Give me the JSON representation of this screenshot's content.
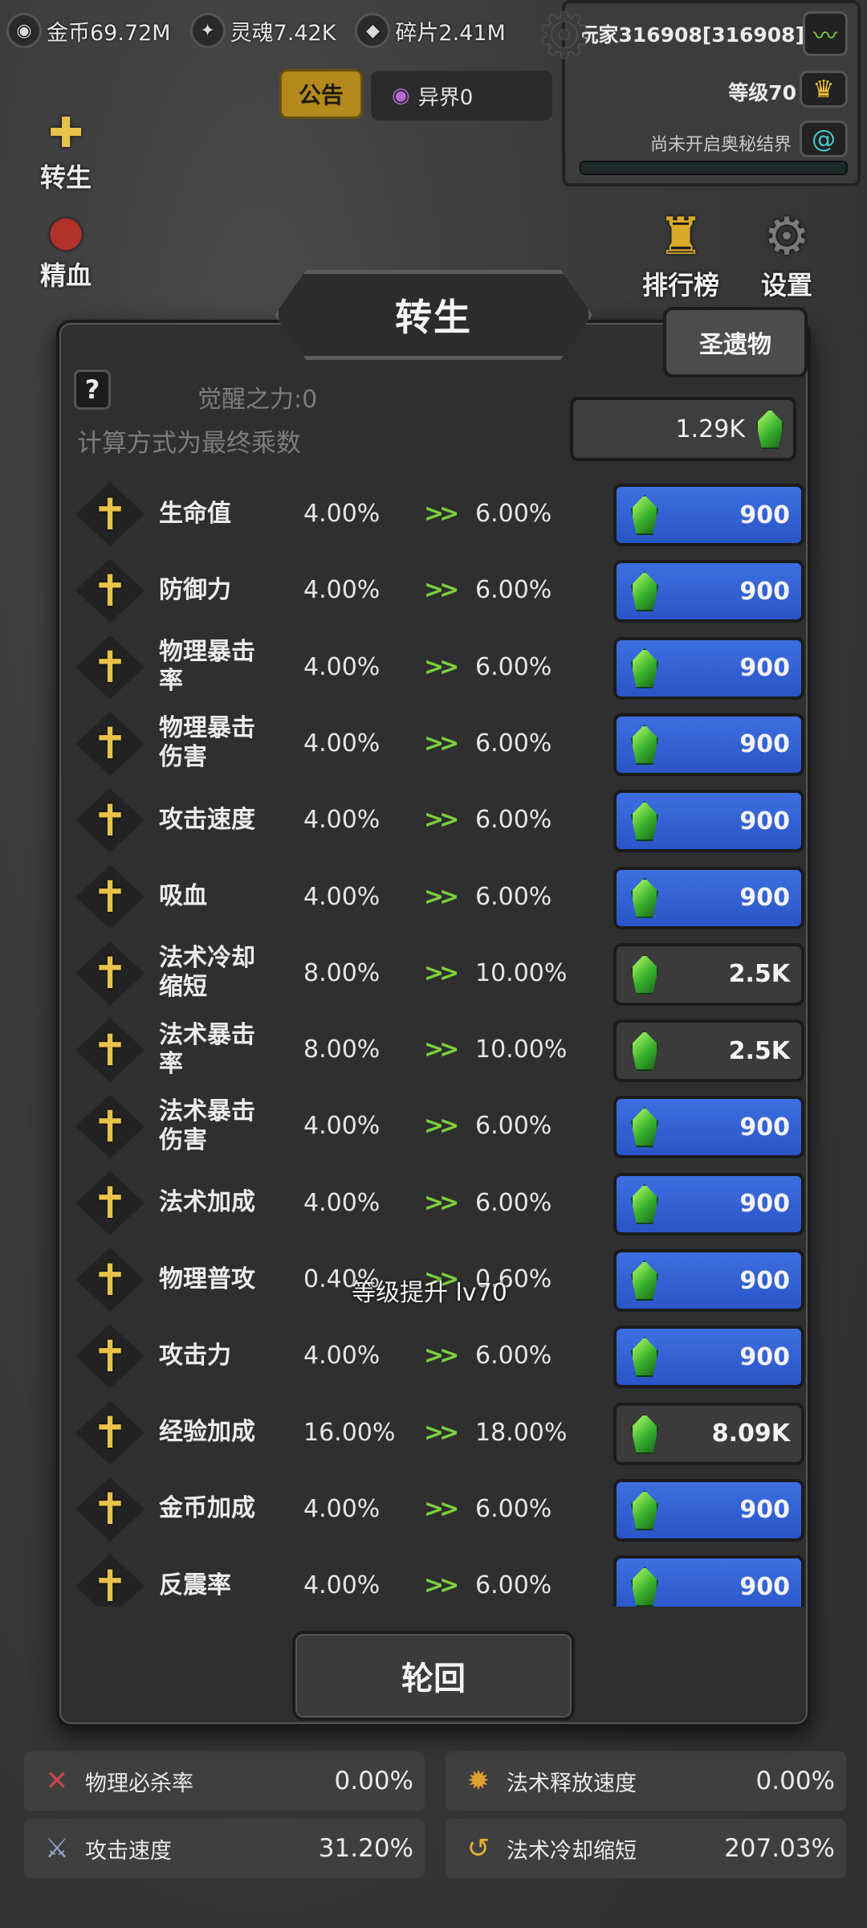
{
  "topbar": {
    "gold": "金币69.72M",
    "soul": "灵魂7.42K",
    "fragment": "碎片2.41M"
  },
  "player": {
    "name": "玩家316908[316908]",
    "level": "等级70",
    "secret": "尚未开启奥秘结界"
  },
  "top_buttons": {
    "notice": "公告",
    "otherworld": "异界0"
  },
  "side_menu": {
    "rebirth": "转生",
    "essence": "精血"
  },
  "right_icons": {
    "ranking": "排行榜",
    "settings": "设置"
  },
  "modal": {
    "title": "转生",
    "relic_button": "圣遗物",
    "help": "?",
    "awaken": "觉醒之力:0",
    "calc_note": "计算方式为最终乘数",
    "total": "1.29K",
    "levelup_toast": "等级提升 lv70",
    "reincarnate_button": "轮回",
    "arrow": ">>",
    "rows": [
      {
        "name": "生命值",
        "cur": "4.00%",
        "next": "6.00%",
        "cost": "900",
        "style": "blue"
      },
      {
        "name": "防御力",
        "cur": "4.00%",
        "next": "6.00%",
        "cost": "900",
        "style": "blue"
      },
      {
        "name": "物理暴击率",
        "cur": "4.00%",
        "next": "6.00%",
        "cost": "900",
        "style": "blue"
      },
      {
        "name": "物理暴击伤害",
        "cur": "4.00%",
        "next": "6.00%",
        "cost": "900",
        "style": "blue"
      },
      {
        "name": "攻击速度",
        "cur": "4.00%",
        "next": "6.00%",
        "cost": "900",
        "style": "blue"
      },
      {
        "name": "吸血",
        "cur": "4.00%",
        "next": "6.00%",
        "cost": "900",
        "style": "blue"
      },
      {
        "name": "法术冷却缩短",
        "cur": "8.00%",
        "next": "10.00%",
        "cost": "2.5K",
        "style": "gray"
      },
      {
        "name": "法术暴击率",
        "cur": "8.00%",
        "next": "10.00%",
        "cost": "2.5K",
        "style": "gray"
      },
      {
        "name": "法术暴击伤害",
        "cur": "4.00%",
        "next": "6.00%",
        "cost": "900",
        "style": "blue"
      },
      {
        "name": "法术加成",
        "cur": "4.00%",
        "next": "6.00%",
        "cost": "900",
        "style": "blue"
      },
      {
        "name": "物理普攻",
        "cur": "0.40%",
        "next": "0.60%",
        "cost": "900",
        "style": "blue"
      },
      {
        "name": "攻击力",
        "cur": "4.00%",
        "next": "6.00%",
        "cost": "900",
        "style": "blue"
      },
      {
        "name": "经验加成",
        "cur": "16.00%",
        "next": "18.00%",
        "cost": "8.09K",
        "style": "gray"
      },
      {
        "name": "金币加成",
        "cur": "4.00%",
        "next": "6.00%",
        "cost": "900",
        "style": "blue"
      },
      {
        "name": "反震率",
        "cur": "4.00%",
        "next": "6.00%",
        "cost": "900",
        "style": "blue"
      }
    ]
  },
  "bottom_stats": [
    [
      {
        "label": "物理必杀率",
        "value": "0.00%",
        "icon": "crossed-swords-icon"
      },
      {
        "label": "法术释放速度",
        "value": "0.00%",
        "icon": "flame-icon"
      }
    ],
    [
      {
        "label": "攻击速度",
        "value": "31.20%",
        "icon": "sword-icon"
      },
      {
        "label": "法术冷却缩短",
        "value": "207.03%",
        "icon": "swirl-icon"
      }
    ]
  ]
}
